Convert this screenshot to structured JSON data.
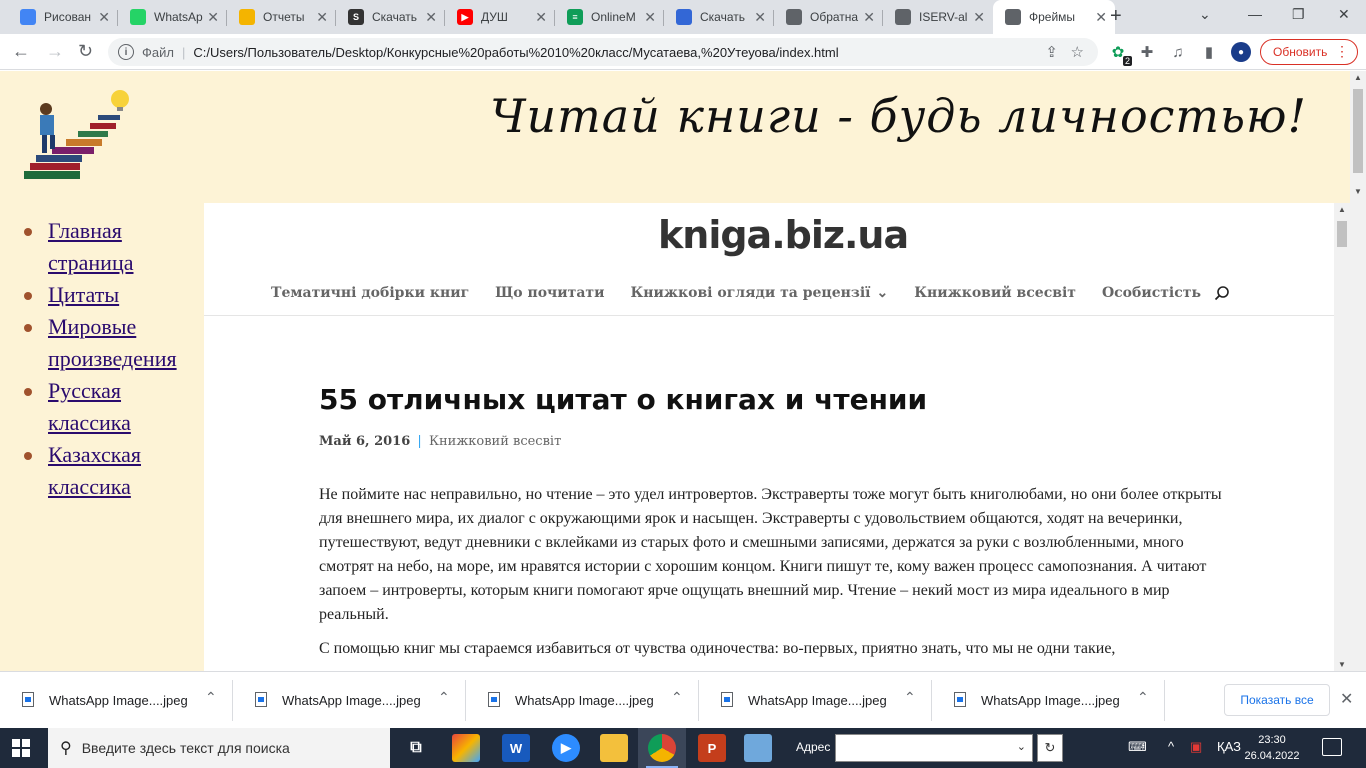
{
  "browser": {
    "tabs": [
      {
        "title": "Рисован",
        "favicon_color": "#4285f4",
        "favicon_label": ""
      },
      {
        "title": "WhatsAp",
        "favicon_color": "#25d366",
        "favicon_label": ""
      },
      {
        "title": "Отчеты",
        "favicon_color": "#f4b400",
        "favicon_label": ""
      },
      {
        "title": "Скачать",
        "favicon_color": "#333333",
        "favicon_label": "S"
      },
      {
        "title": "ДУШ",
        "favicon_color": "#ff0000",
        "favicon_label": "▶"
      },
      {
        "title": "OnlineM",
        "favicon_color": "#0f9d58",
        "favicon_label": "≡"
      },
      {
        "title": "Скачать",
        "favicon_color": "#3367d6",
        "favicon_label": ""
      },
      {
        "title": "Обратна",
        "favicon_color": "#5f6368",
        "favicon_label": ""
      },
      {
        "title": "ISERV-al",
        "favicon_color": "#5f6368",
        "favicon_label": ""
      },
      {
        "title": "Фреймы",
        "favicon_color": "#5f6368",
        "favicon_label": ""
      }
    ],
    "active_tab_index": 9,
    "omnibox": {
      "scheme_label": "Файл",
      "url": "C:/Users/Пользователь/Desktop/Конкурсные%20работы%2010%20класс/Мусатаева,%20Утеуова/index.html"
    },
    "extension_badge": "2",
    "update_button_label": "Обновить"
  },
  "page": {
    "slogan": "Читай книги - будь личностью!",
    "sidebar_links": [
      "Главная страница",
      "Цитаты",
      "Мировые произведения",
      "Русская классика",
      "Казахская классика"
    ],
    "frame": {
      "site_logo": "kniga.biz.ua",
      "nav_items": [
        "Тематичні добірки книг",
        "Що почитати",
        "Книжкові огляди та рецензії",
        "Книжковий всесвіт",
        "Особистість"
      ],
      "nav_dropdown_indicator": "⌄",
      "article": {
        "title": "55 отличных цитат о книгах и чтении",
        "date": "Май 6, 2016",
        "separator": "|",
        "category": "Книжковий всесвіт",
        "paragraphs": [
          "Не поймите нас неправильно, но чтение – это удел интровертов. Экстраверты тоже могут быть книголюбами, но они более открыты для внешнего мира, их диалог с окружающими ярок и насыщен. Экстраверты с удовольствием общаются, ходят на вечеринки, путешествуют, ведут дневники с вклейками из старых фото и смешными записями, держатся за руки с возлюбленными, много смотрят на небо, на море, им нравятся истории с хорошим концом. Книги пишут те, кому важен процесс самопознания. А читают запоем – интроверты, которым книги помогают ярче ощущать внешний мир. Чтение – некий мост из мира идеального в мир реальный.",
          "С помощью книг мы стараемся избавиться от чувства одиночества: во-первых, приятно знать, что мы не одни такие,"
        ]
      }
    }
  },
  "downloads": {
    "items": [
      "WhatsApp Image....jpeg",
      "WhatsApp Image....jpeg",
      "WhatsApp Image....jpeg",
      "WhatsApp Image....jpeg",
      "WhatsApp Image....jpeg"
    ],
    "show_all_label": "Показать все"
  },
  "taskbar": {
    "search_placeholder": "Введите здесь текст для поиска",
    "address_label": "Адрес",
    "language": "ҚАЗ",
    "time": "23:30",
    "date": "26.04.2022"
  }
}
